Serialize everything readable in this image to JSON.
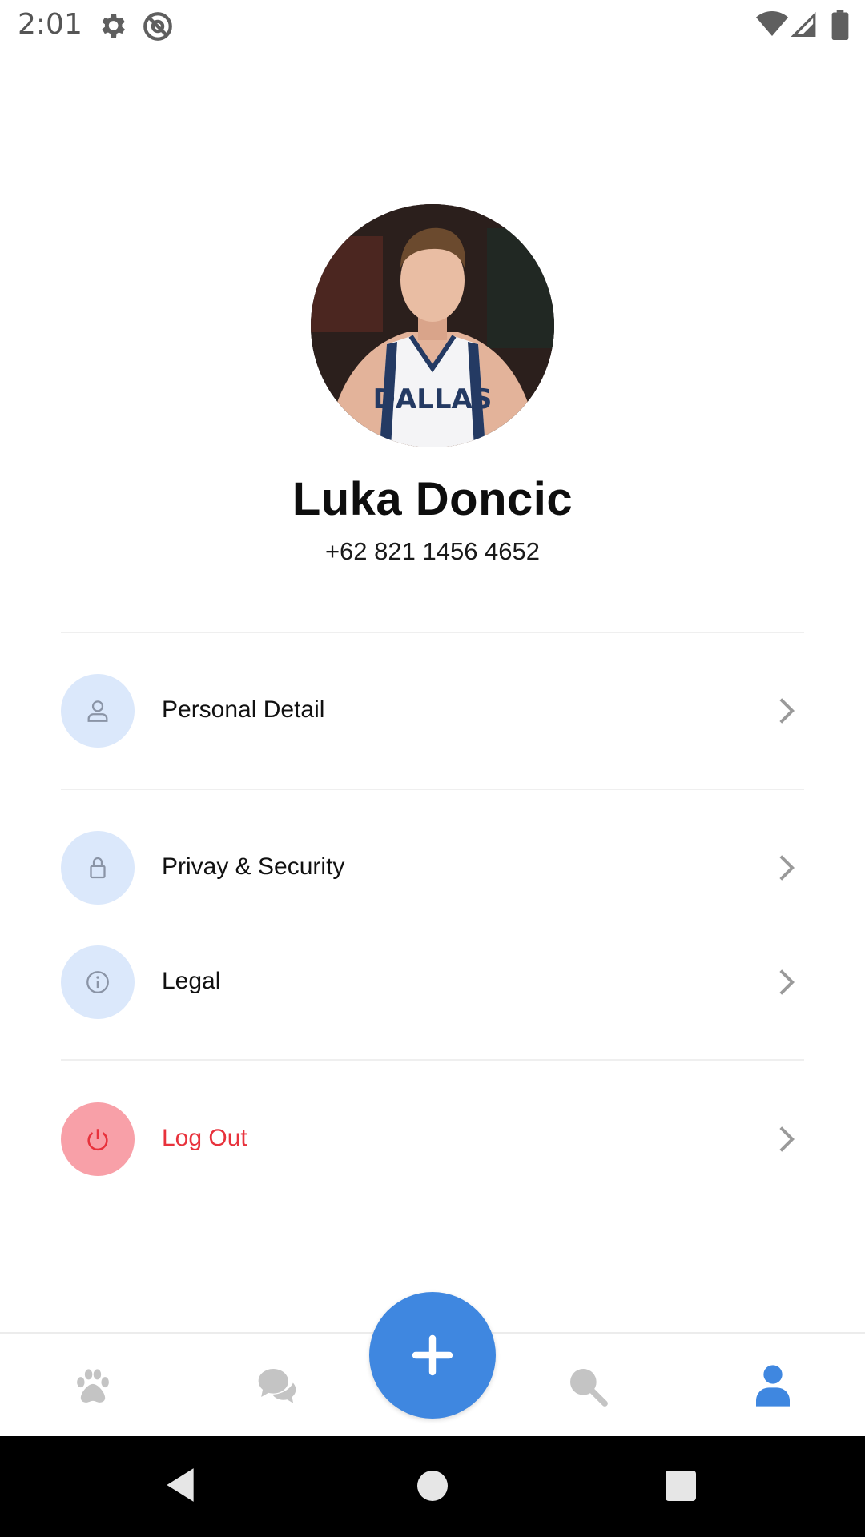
{
  "status_bar": {
    "time": "2:01",
    "icons": [
      "settings-gear-icon",
      "at-sign-icon",
      "wifi-icon",
      "cellular-signal-icon",
      "battery-icon"
    ]
  },
  "profile": {
    "name": "Luka Doncic",
    "phone": "+62 821 1456 4652",
    "avatar_jersey_text": "DALLAS"
  },
  "menu": [
    {
      "label": "Personal Detail",
      "icon": "person-icon"
    },
    {
      "label": "Privay & Security",
      "icon": "lock-icon"
    },
    {
      "label": "Legal",
      "icon": "info-icon"
    },
    {
      "label": "Log Out",
      "icon": "power-icon"
    }
  ],
  "bottom_nav": {
    "items": [
      "paw-icon",
      "chat-icon",
      "add-icon",
      "search-icon",
      "profile-icon"
    ],
    "active": "profile-icon"
  },
  "colors": {
    "accent": "#3f87e0",
    "icon_bg": "#dbe8fb",
    "danger": "#e8323c",
    "danger_bg": "#f8a0a8",
    "inactive_icon": "#c4c4c4"
  }
}
